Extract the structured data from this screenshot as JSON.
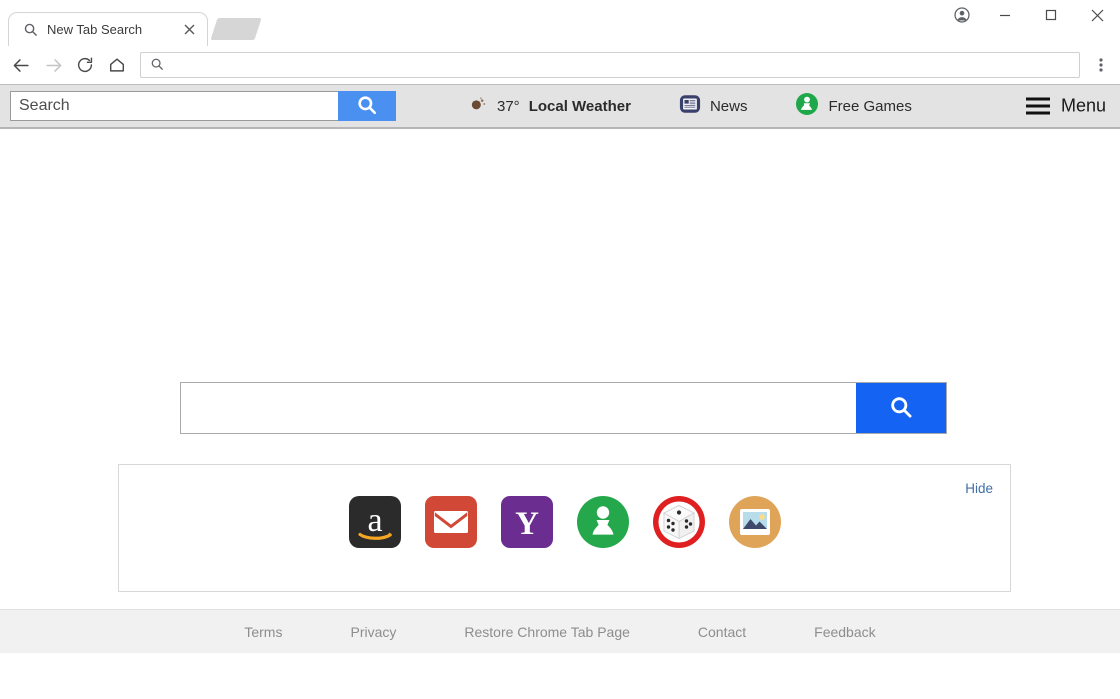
{
  "browser": {
    "tab": {
      "title": "New Tab Search",
      "favicon_icon": "search-icon",
      "close_icon": "close-icon"
    },
    "new_tab_button_icon": "new-tab-icon",
    "window_controls": {
      "profile_icon": "profile-avatar-icon",
      "minimize_icon": "minimize-icon",
      "maximize_icon": "maximize-icon",
      "close_icon": "close-icon"
    },
    "nav": {
      "back_icon": "back-arrow-icon",
      "forward_icon": "forward-arrow-icon",
      "reload_icon": "reload-icon",
      "home_icon": "home-icon",
      "menu_icon": "three-dot-menu-icon"
    },
    "omnibox": {
      "icon": "search-icon",
      "value": "",
      "placeholder": ""
    }
  },
  "ext_toolbar": {
    "search": {
      "value": "",
      "placeholder": "Search",
      "button_icon": "search-icon",
      "button_color": "#4a90f0"
    },
    "links": [
      {
        "icon": "weather-icon",
        "temp": "37°",
        "label": "Local Weather"
      },
      {
        "icon": "news-icon",
        "temp": "",
        "label": "News"
      },
      {
        "icon": "free-games-pawn-icon",
        "temp": "",
        "label": "Free Games"
      }
    ],
    "menu": {
      "label": "Menu",
      "icon": "hamburger-menu-icon"
    }
  },
  "main": {
    "search": {
      "value": "",
      "placeholder": "",
      "button_icon": "search-icon",
      "button_color": "#1463f3"
    },
    "shortcut_panel": {
      "hide_label": "Hide",
      "shortcuts": [
        {
          "name": "amazon",
          "icon": "amazon-icon",
          "color": "#2b2b2b"
        },
        {
          "name": "mail",
          "icon": "gmail-envelope-icon",
          "color": "#d14836"
        },
        {
          "name": "yahoo",
          "icon": "yahoo-icon",
          "color": "#6b2d8f"
        },
        {
          "name": "free-games",
          "icon": "free-games-pawn-icon",
          "color": "#25a84b"
        },
        {
          "name": "dice-games",
          "icon": "dice-icon",
          "color": "#e02020"
        },
        {
          "name": "photos",
          "icon": "photo-image-icon",
          "color": "#e0a458"
        }
      ]
    }
  },
  "footer": {
    "links": [
      "Terms",
      "Privacy",
      "Restore Chrome Tab Page",
      "Contact",
      "Feedback"
    ]
  }
}
